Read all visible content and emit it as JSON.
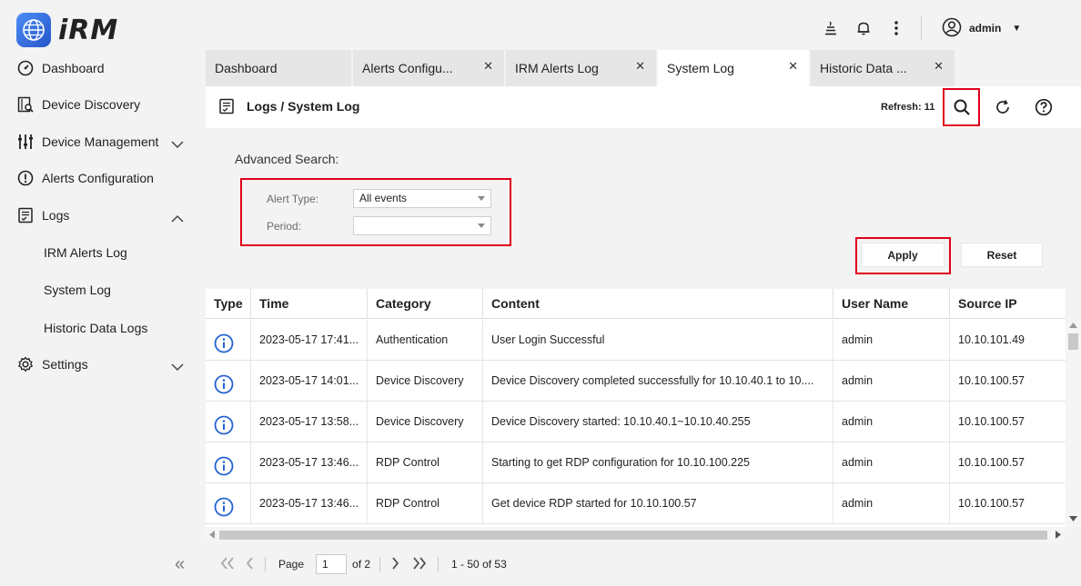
{
  "app": {
    "logo_text": "iRM"
  },
  "sidebar": {
    "items": [
      {
        "label": "Dashboard"
      },
      {
        "label": "Device Discovery"
      },
      {
        "label": "Device Management"
      },
      {
        "label": "Alerts Configuration"
      },
      {
        "label": "Logs"
      },
      {
        "label": "Settings"
      }
    ],
    "logs_sub": [
      {
        "label": "IRM Alerts Log"
      },
      {
        "label": "System Log"
      },
      {
        "label": "Historic Data Logs"
      }
    ],
    "collapse_glyph": "«"
  },
  "topbar": {
    "user": "admin"
  },
  "tabs": [
    {
      "label": "Dashboard",
      "closable": false
    },
    {
      "label": "Alerts Configu...",
      "closable": true
    },
    {
      "label": "IRM Alerts Log",
      "closable": true
    },
    {
      "label": "System Log",
      "closable": true,
      "active": true
    },
    {
      "label": "Historic Data ...",
      "closable": true
    }
  ],
  "panel": {
    "breadcrumb": "Logs / System Log",
    "refresh": "Refresh: 11"
  },
  "search": {
    "title": "Advanced Search:",
    "alert_type_label": "Alert Type:",
    "alert_type_value": "All events",
    "period_label": "Period:",
    "period_value": "",
    "apply": "Apply",
    "reset": "Reset"
  },
  "table": {
    "headers": [
      "Type",
      "Time",
      "Category",
      "Content",
      "User Name",
      "Source IP"
    ],
    "rows": [
      {
        "time": "2023-05-17 17:41...",
        "category": "Authentication",
        "content": "User Login Successful",
        "user": "admin",
        "ip": "10.10.101.49"
      },
      {
        "time": "2023-05-17 14:01...",
        "category": "Device Discovery",
        "content": "Device Discovery completed successfully for 10.10.40.1 to 10....",
        "user": "admin",
        "ip": "10.10.100.57"
      },
      {
        "time": "2023-05-17 13:58...",
        "category": "Device Discovery",
        "content": "Device Discovery started: 10.10.40.1~10.10.40.255",
        "user": "admin",
        "ip": "10.10.100.57"
      },
      {
        "time": "2023-05-17 13:46...",
        "category": "RDP Control",
        "content": "Starting to get RDP configuration for 10.10.100.225",
        "user": "admin",
        "ip": "10.10.100.57"
      },
      {
        "time": "2023-05-17 13:46...",
        "category": "RDP Control",
        "content": "Get device RDP started for 10.10.100.57",
        "user": "admin",
        "ip": "10.10.100.57"
      }
    ]
  },
  "pager": {
    "page_label": "Page",
    "page_value": "1",
    "of_label": "of 2",
    "range": "1 - 50 of 53"
  },
  "colors": {
    "accent": "#2463d1",
    "highlight": "#e0001b"
  }
}
